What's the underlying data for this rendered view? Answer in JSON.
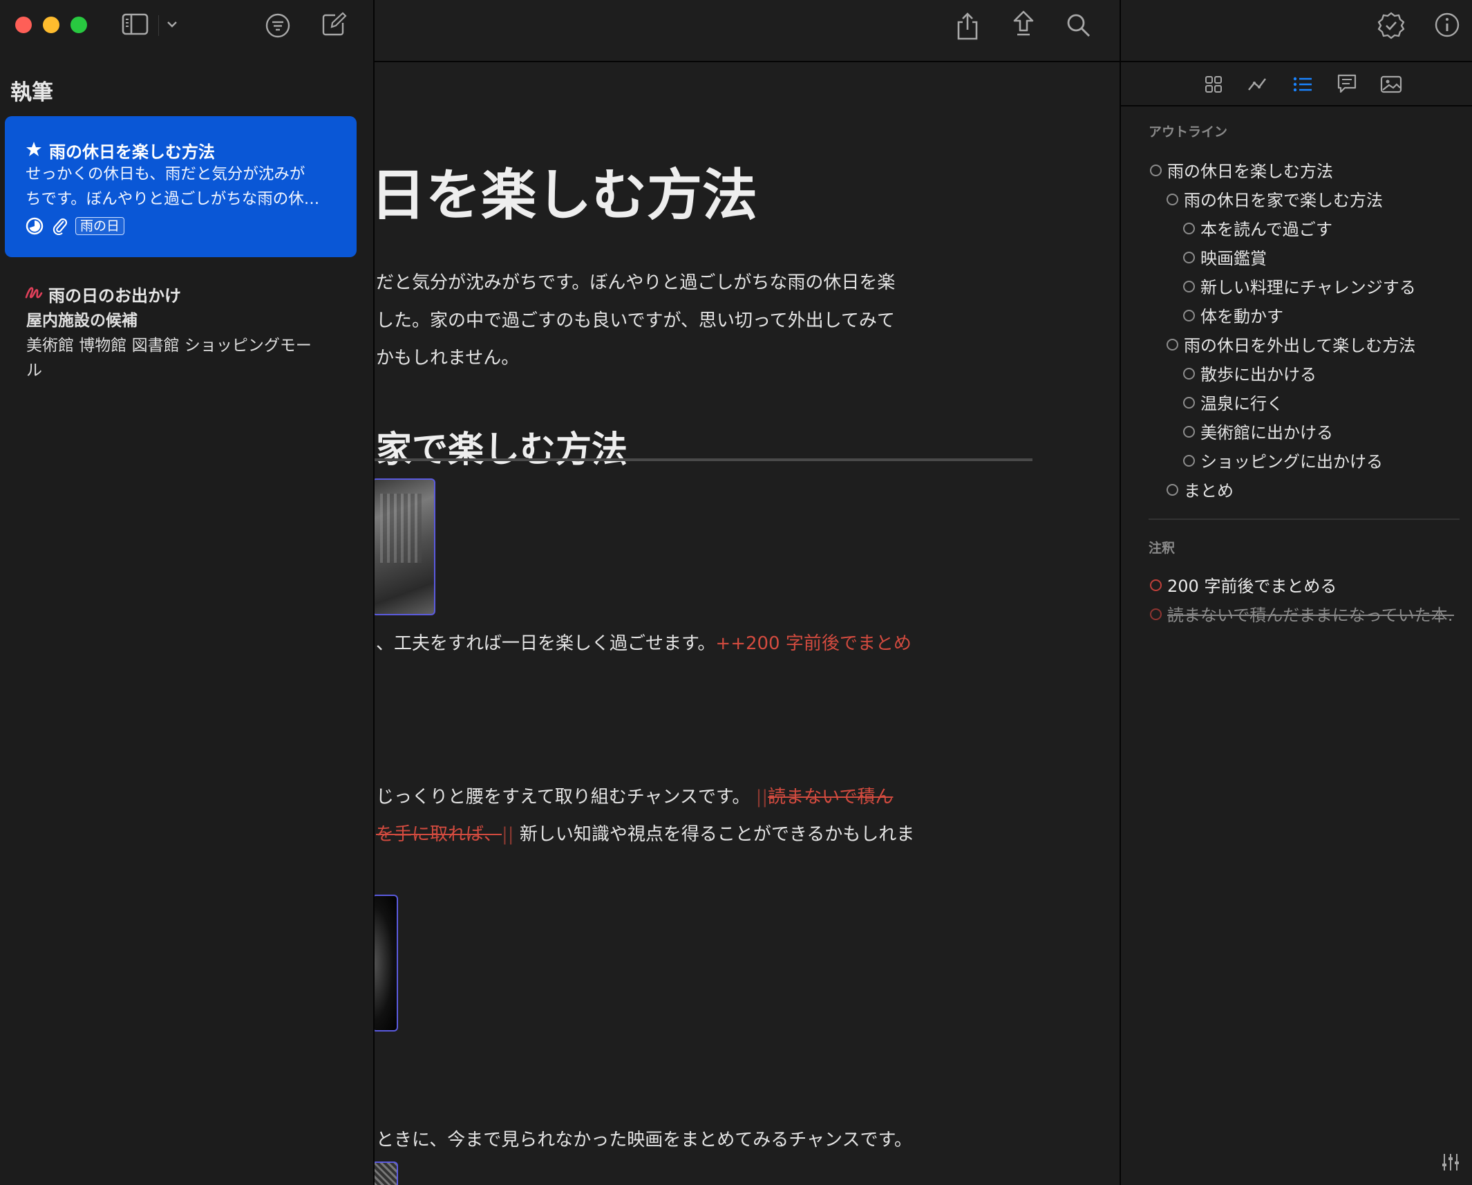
{
  "sidebar": {
    "title": "執筆",
    "notes": [
      {
        "title": "雨の休日を楽しむ方法",
        "preview_line1": "せっかくの休日も、雨だと気分が沈みが",
        "preview_line2": "ちです。ぼんやりと過ごしがちな雨の休…",
        "tag": "雨の日"
      },
      {
        "title": "雨の日のお出かけ",
        "subtitle": "屋内施設の候補",
        "preview_line1": "美術館 博物館 図書館 ショッピングモー",
        "preview_line2": "ル"
      }
    ]
  },
  "editor": {
    "heading": "日を楽しむ方法",
    "para1_line1": "だと気分が沈みがちです。ぼんやりと過ごしがちな雨の休日を楽",
    "para1_line2": "した。家の中で過ごすのも良いですが、思い切って外出してみて",
    "para1_line3": "かもしれません。",
    "subheading": "家で楽しむ方法",
    "para2": "、工夫をすれば一日を楽しく過ごせます。",
    "para2_annotation": "++200 字前後でまとめ",
    "para3_line1": "じっくりと腰をすえて取り組むチャンスです。",
    "para3_deleted_marker": "||",
    "para3_deleted1": "読まないで積ん",
    "para3_deleted2": "を手に取れば、",
    "para3_deleted_marker2": "||",
    "para3_line2": "新しい知識や視点を得ることができるかもしれま",
    "para4": "ときに、今まで見られなかった映画をまとめてみるチャンスです。"
  },
  "right_panel": {
    "outline_label": "アウトライン",
    "outline": [
      {
        "text": "雨の休日を楽しむ方法",
        "level": 0
      },
      {
        "text": "雨の休日を家で楽しむ方法",
        "level": 1
      },
      {
        "text": "本を読んで過ごす",
        "level": 2
      },
      {
        "text": "映画鑑賞",
        "level": 2
      },
      {
        "text": "新しい料理にチャレンジする",
        "level": 2
      },
      {
        "text": "体を動かす",
        "level": 2
      },
      {
        "text": "雨の休日を外出して楽しむ方法",
        "level": 1
      },
      {
        "text": "散歩に出かける",
        "level": 2
      },
      {
        "text": "温泉に行く",
        "level": 2
      },
      {
        "text": "美術館に出かける",
        "level": 2
      },
      {
        "text": "ショッピングに出かける",
        "level": 2
      },
      {
        "text": "まとめ",
        "level": 1
      }
    ],
    "annotations_label": "注釈",
    "annotations": [
      {
        "text": "200 字前後でまとめる",
        "struck": false
      },
      {
        "text": "読まないで積んだままになっていた本…",
        "struck": true
      }
    ]
  },
  "colors": {
    "accent": "#0a57d6",
    "tab_active": "#1a84ff",
    "annotation_red": "#d34b3f",
    "close": "#fe5f57",
    "minimize": "#febc2e",
    "zoom": "#28c840"
  },
  "icons": {
    "toolbar_left": [
      "sidebar-toggle-icon",
      "chevron-down-icon",
      "filter-icon",
      "compose-icon"
    ],
    "toolbar_center": [
      "share-icon",
      "publish-icon",
      "search-icon"
    ],
    "toolbar_right": [
      "badge-check-icon",
      "info-icon"
    ],
    "panel_tabs": [
      "grid-icon",
      "stats-icon",
      "outline-icon",
      "comment-icon",
      "image-icon"
    ],
    "bottom_right": "adjust-icon"
  }
}
